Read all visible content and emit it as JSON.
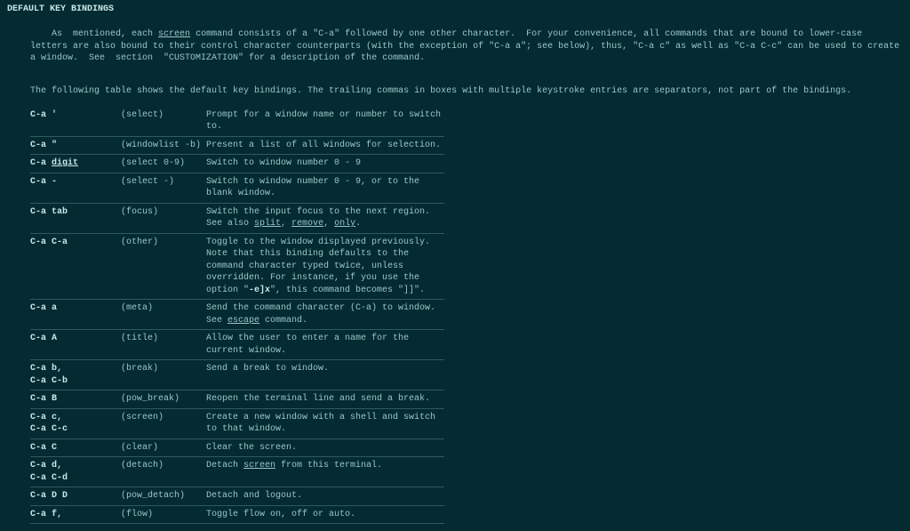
{
  "heading": "DEFAULT KEY BINDINGS",
  "intro_parts": {
    "p1a": "As  mentioned, each ",
    "p1_link": "screen",
    "p1b": " command consists of a \"C-a\" followed by one other character.  For your convenience, all commands that are bound to lower-case letters are also bound to their control character counterparts (with the exception of \"C-a a\"; see below), thus, \"C-a c\" as well as \"C-a C-c\" can be used to create a window.  See  section  \"CUSTOMIZATION\" for a description of the command."
  },
  "subhead": "The following table shows the default key bindings. The trailing commas in boxes with multiple keystroke entries are separators, not part of the bindings.",
  "rows": [
    {
      "keys_html": "C-a '",
      "cmd": "(select)",
      "desc_html": "Prompt  for  a window name or number to switch to."
    },
    {
      "keys_html": "C-a \"",
      "cmd": "(windowlist -b)",
      "desc_html": "Present a list of all windows for selection."
    },
    {
      "keys_html": "C-a <span class=\"u\">digit</span>",
      "cmd": "(select 0-9)",
      "desc_html": "Switch to window number 0 - 9"
    },
    {
      "keys_html": "C-a -",
      "cmd": "(select -)",
      "desc_html": "Switch to window number 0 - 9, or to the blank window."
    },
    {
      "keys_html": "C-a tab",
      "cmd": "(focus)",
      "desc_html": "Switch  the  input  focus  to the next region. See also <span class=\"u\">split</span>, <span class=\"u\">remove</span>, <span class=\"u\">only</span>."
    },
    {
      "keys_html": "C-a C-a",
      "cmd": "(other)",
      "desc_html": "Toggle to  the  window  displayed  previously. Note that this binding defaults to the command character typed twice, unless overridden.  For instance,  if  you use the option \"<span class=\"b\">-e]x</span>\", this command becomes \"]]\"."
    },
    {
      "keys_html": "C-a a",
      "cmd": "(meta)",
      "desc_html": "Send the command character  (C-a)  to  window. See <span class=\"u\">escape</span> command."
    },
    {
      "keys_html": "C-a A",
      "cmd": "(title)",
      "desc_html": "Allow the user to enter a name for the current window."
    },
    {
      "keys_html": "C-a b,\nC-a C-b",
      "cmd": "(break)",
      "desc_html": "Send a break to window."
    },
    {
      "keys_html": "C-a B",
      "cmd": "(pow_break)",
      "desc_html": "Reopen the terminal line and send a break."
    },
    {
      "keys_html": "C-a c,\nC-a C-c",
      "cmd": "(screen)",
      "desc_html": "Create a new window with a shell and switch to that window."
    },
    {
      "keys_html": "C-a C",
      "cmd": "(clear)",
      "desc_html": "Clear the screen."
    },
    {
      "keys_html": "C-a d,\nC-a C-d",
      "cmd": "(detach)",
      "desc_html": "Detach <span class=\"u\">screen</span> from this terminal."
    },
    {
      "keys_html": "C-a D D",
      "cmd": "(pow_detach)",
      "desc_html": "Detach and logout."
    },
    {
      "keys_html": "C-a f,",
      "cmd": "(flow)",
      "desc_html": "Toggle flow on, off or auto."
    }
  ]
}
